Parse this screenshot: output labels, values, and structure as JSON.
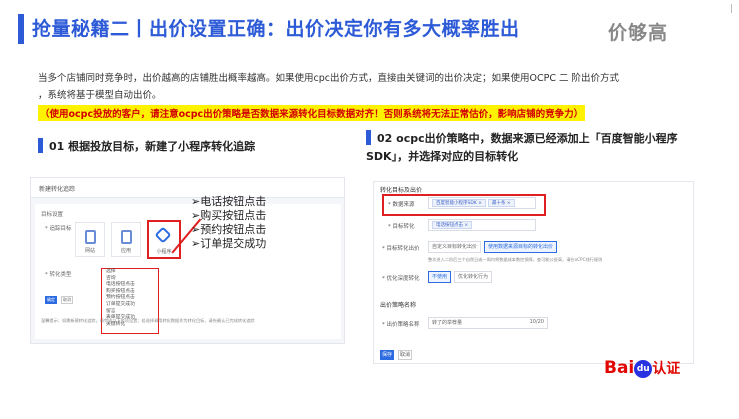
{
  "header": {
    "title": "抢量秘籍二丨出价设置正确：出价决定你有多大概率胜出",
    "brand": "价够高",
    "corner": "|"
  },
  "intro": {
    "line1": "当多个店铺同时竞争时，出价越高的店铺胜出概率越高。如果使用cpc出价方式，直接由关键词的出价决定；如果使用OCPC 二 阶出价方式",
    "line2": "，系统将基于模型自动出价。",
    "highlight": "（使用ocpc投放的客户，请注意ocpc出价策略是否数据来源转化目标数据对齐！否则系统将无法正常估价，影响店铺的竞争力）"
  },
  "section1": {
    "title": "01 根据投放目标，新建了小程序转化追踪"
  },
  "section2": {
    "title": "02 ocpc出价策略中，数据来源已经添加上「百度智能小程序SDK」，并选择对应的目标转化"
  },
  "left_shot": {
    "header": "新建转化追踪",
    "section": "目标设置",
    "field1": "* 追踪目标",
    "field2": "* 转化类型",
    "tiles": [
      "网站",
      "应用",
      "小程序"
    ],
    "dropdown": [
      "选择",
      "咨询",
      "电话按钮点击",
      "购买按钮点击",
      "预约按钮点击",
      "订单提交成功",
      "留言",
      "表单提交成功",
      "关键转化"
    ],
    "btn_ok": "确定",
    "btn_cancel": "取消",
    "note": "温馨提示：如需新建转化追踪，请完成以下各项设置；若选择调用转化数据作为转化目标，请先确认已完成转化追踪"
  },
  "events": [
    "➢电话按钮点击",
    "➢购买按钮点击",
    "➢预约按钮点击",
    "➢订单提交成功"
  ],
  "right_shot": {
    "section1": "转化目标及出价",
    "row1_label": "* 数据来源",
    "row1_tags": [
      "百度智能小程序SDK ×",
      "最十条 ×"
    ],
    "row2_label": "* 目标转化",
    "row2_tags": [
      "电话按钮点击 ×"
    ],
    "row3_label": "* 目标转化出价",
    "row3_opt1": "自定义目标转化出价",
    "row3_opt2": "使用数据来源目标的转化出价",
    "row3_note": "整次进入二阶后三个自然日或一周内将数据成本数控保障，查可能公很高，请在oCPC线行规则",
    "row4_label": "* 优化深度转化",
    "row4_opt1": "不使用",
    "row4_opt2": "优化转化行为",
    "section2": "出价策略名称",
    "row5_label": "* 出价策略名称",
    "row5_value": "转了的举荐量",
    "row5_count": "10/20",
    "btn_save": "保存",
    "btn_cancel": "取消"
  },
  "logo": {
    "bai": "Bai",
    "du": "du",
    "rz": "认证"
  },
  "colors": {
    "accent": "#2d5bd7",
    "red": "#e02020",
    "highlight_bg": "#fff200"
  }
}
